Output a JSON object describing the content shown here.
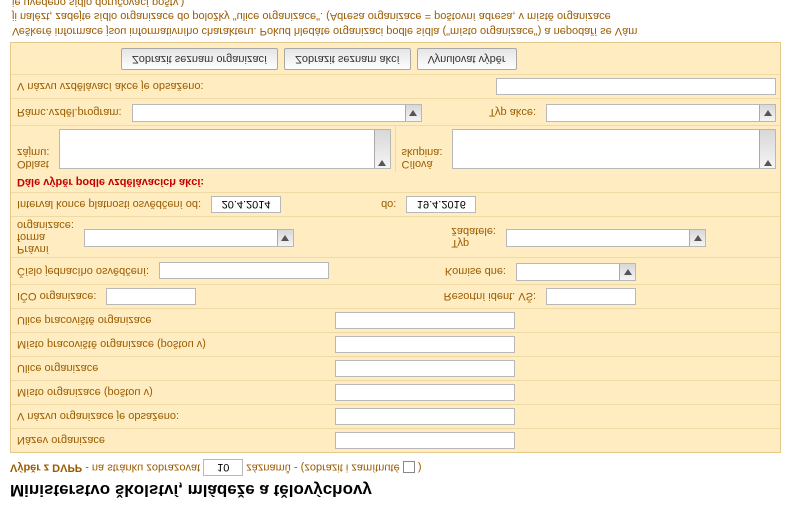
{
  "header": {
    "title": "Ministerstvo školství, mládeže a tělovýchovy"
  },
  "legend": {
    "prefix_bold": "Výběr z DVPP",
    "rest1": " - na stránku zobrazovat ",
    "records_value": "10",
    "rest2": " záznamů - (zobrazit i zamítnuté ",
    "rest3": ")"
  },
  "labels": {
    "org_name": "Název organizace",
    "org_name_contains": "V názvu organizace je obsaženo:",
    "org_place_post": "Místo organizace (poštou v)",
    "org_street": "Ulice organizace",
    "work_place_post": "Místo pracoviště organizace (poštou v)",
    "work_street": "Ulice pracoviště organizace",
    "ico": "IČO organizace:",
    "res_id": "Resortní ident. VŠ:",
    "cj": "Číslo jednacího osvědčení:",
    "commission": "Komise dne:",
    "legal_form_l1": "Právní",
    "legal_form_l2": "forma",
    "legal_form_l3": "organizace:",
    "applicant_l1": "Typ",
    "applicant_l2": "žadatele:",
    "interval_from": "Interval konce platnosti osvědčení od:",
    "interval_to": "do:",
    "section_edu": "Dále výběr podle vzdělávacích akcí:",
    "oblast_l1": "Oblast",
    "oblast_l2": "zájmu:",
    "target_l1": "Cílová",
    "target_l2": "skupina:",
    "edu_prog": "Rámc.vzděl.program:",
    "action_type": "Typ akce:",
    "edu_name": "V názvu vzdělávací akce je obsaženo:"
  },
  "values": {
    "date_from": "20.4.2014",
    "date_to": "19.4.2016"
  },
  "buttons": {
    "show_org": "Zobrazit seznam organizací",
    "show_actions": "Zobrazit seznam akcí",
    "clear": "Vynulovat výběr"
  },
  "footer": {
    "line1": "Veškeré informace jsou informativního charakteru. Pokud hledáte organizaci podle sídla (\"místo organizace\") a nepodaří se Vám",
    "line2": "ji nalézt, zadejte sídlo organizace do položky \"ulice organizace\". (Adresa organizace = poštovní adresa, v místě organizace",
    "line3": "je uvedeno sídlo doručovací pošty.)"
  }
}
